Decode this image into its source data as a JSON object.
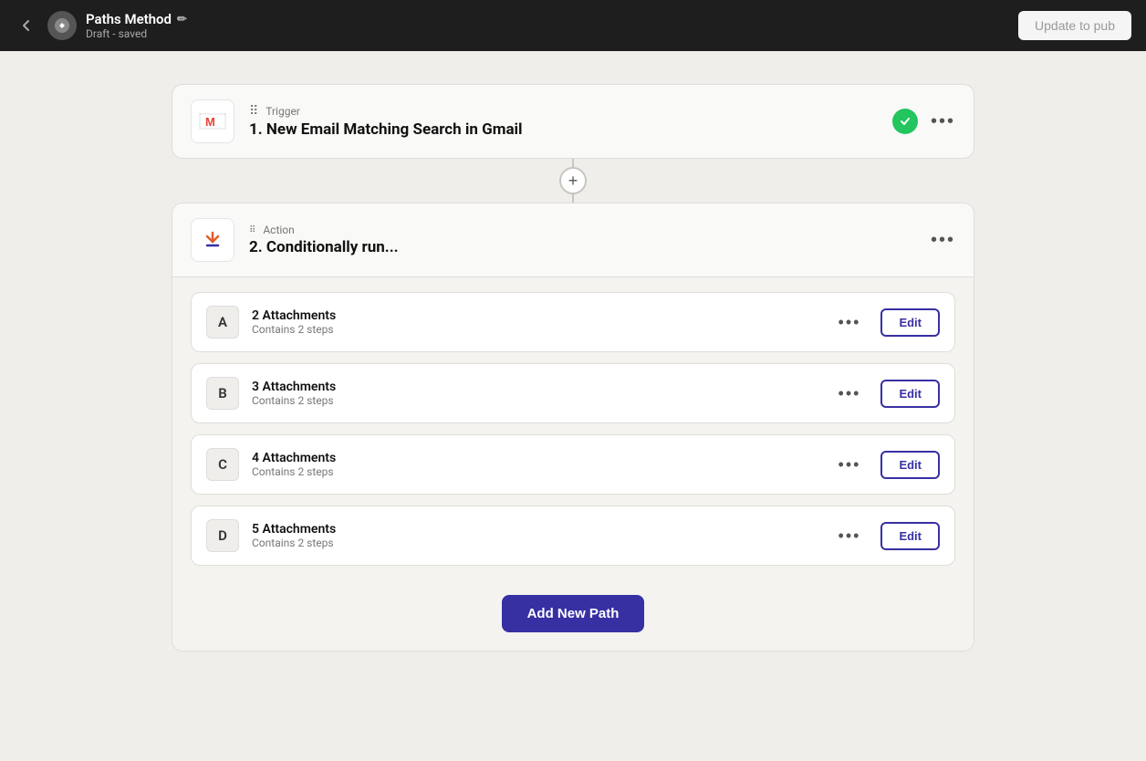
{
  "topnav": {
    "back_label": "←",
    "title": "Paths Method",
    "subtitle": "Draft - saved",
    "edit_icon": "✏",
    "update_button": "Update to pub"
  },
  "trigger": {
    "label": "Trigger",
    "dots": "•••",
    "title": "1. New Email Matching Search in Gmail",
    "status": "✓"
  },
  "connector": {
    "add_icon": "+"
  },
  "action": {
    "label": "Action",
    "dots": "•••",
    "title": "2. Conditionally run...",
    "more_icon": "•••"
  },
  "paths": [
    {
      "letter": "A",
      "name": "2 Attachments",
      "steps": "Contains 2 steps",
      "edit_label": "Edit"
    },
    {
      "letter": "B",
      "name": "3 Attachments",
      "steps": "Contains 2 steps",
      "edit_label": "Edit"
    },
    {
      "letter": "C",
      "name": "4 Attachments",
      "steps": "Contains 2 steps",
      "edit_label": "Edit"
    },
    {
      "letter": "D",
      "name": "5 Attachments",
      "steps": "Contains 2 steps",
      "edit_label": "Edit"
    }
  ],
  "add_path_label": "Add New Path",
  "colors": {
    "accent": "#3730a3",
    "success": "#22c55e"
  }
}
